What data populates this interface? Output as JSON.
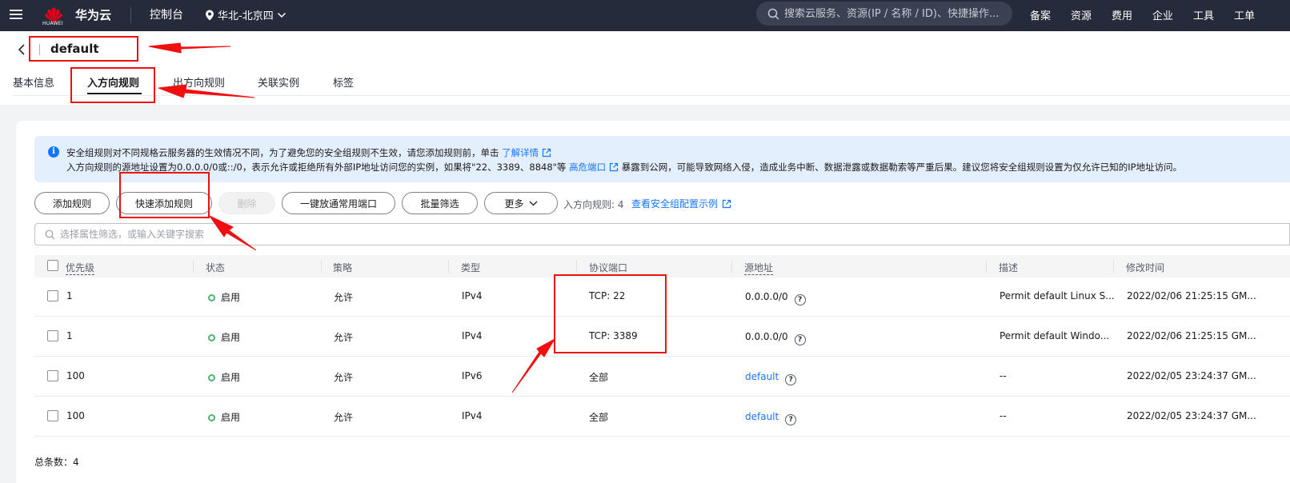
{
  "topbar": {
    "logo_text": "HUAWEI",
    "brand": "华为云",
    "console": "控制台",
    "region": "华北-北京四",
    "search_placeholder": "搜索云服务、资源(IP / 名称 / ID)、快捷操作...",
    "nav": [
      "备案",
      "资源",
      "费用",
      "企业",
      "工具",
      "工单"
    ]
  },
  "header": {
    "title": "default",
    "tabs": [
      "基本信息",
      "入方向规则",
      "出方向规则",
      "关联实例",
      "标签"
    ],
    "active_tab": "入方向规则"
  },
  "notice": {
    "line1": "安全组规则对不同规格云服务器的生效情况不同，为了避免您的安全组规则不生效，请您添加规则前，单击",
    "line1_link": "了解详情",
    "line2_a": "入方向规则的源地址设置为0.0.0.0/0或::/0，表示允许或拒绝所有外部IP地址访问您的实例，如果将\"22、3389、8848\"等",
    "line2_link": "高危端口",
    "line2_b": "暴露到公网，可能导致网络入侵，造成业务中断、数据泄露或数据勒索等严重后果。建议您将安全组规则设置为仅允许已知的IP地址访问。"
  },
  "toolbar": {
    "add": "添加规则",
    "quick_add": "快速添加规则",
    "delete": "删除",
    "open_common": "一键放通常用端口",
    "batch_filter": "批量筛选",
    "more": "更多",
    "count_label": "入方向规则: 4",
    "example_link": "查看安全组配置示例"
  },
  "filter": {
    "placeholder": "选择属性筛选，或输入关键字搜索"
  },
  "table": {
    "headers": {
      "priority": "优先级",
      "status": "状态",
      "policy": "策略",
      "type": "类型",
      "port": "协议端口",
      "source": "源地址",
      "desc": "描述",
      "modified": "修改时间"
    },
    "rows": [
      {
        "priority": "1",
        "status": "启用",
        "policy": "允许",
        "type": "IPv4",
        "port": "TCP: 22",
        "source": "0.0.0.0/0",
        "source_is_link": false,
        "desc": "Permit default Linux S...",
        "modified": "2022/02/06 21:25:15 GM..."
      },
      {
        "priority": "1",
        "status": "启用",
        "policy": "允许",
        "type": "IPv4",
        "port": "TCP: 3389",
        "source": "0.0.0.0/0",
        "source_is_link": false,
        "desc": "Permit default Windo...",
        "modified": "2022/02/06 21:25:15 GM..."
      },
      {
        "priority": "100",
        "status": "启用",
        "policy": "允许",
        "type": "IPv6",
        "port": "全部",
        "source": "default",
        "source_is_link": true,
        "desc": "--",
        "modified": "2022/02/05 23:24:37 GM..."
      },
      {
        "priority": "100",
        "status": "启用",
        "policy": "允许",
        "type": "IPv4",
        "port": "全部",
        "source": "default",
        "source_is_link": true,
        "desc": "--",
        "modified": "2022/02/05 23:24:37 GM..."
      }
    ],
    "total": "总条数：4"
  },
  "colors": {
    "topbar_bg": "#252b3a",
    "link_blue": "#1476ff",
    "status_green": "#50b371",
    "annotation_red": "#f00f0f"
  }
}
